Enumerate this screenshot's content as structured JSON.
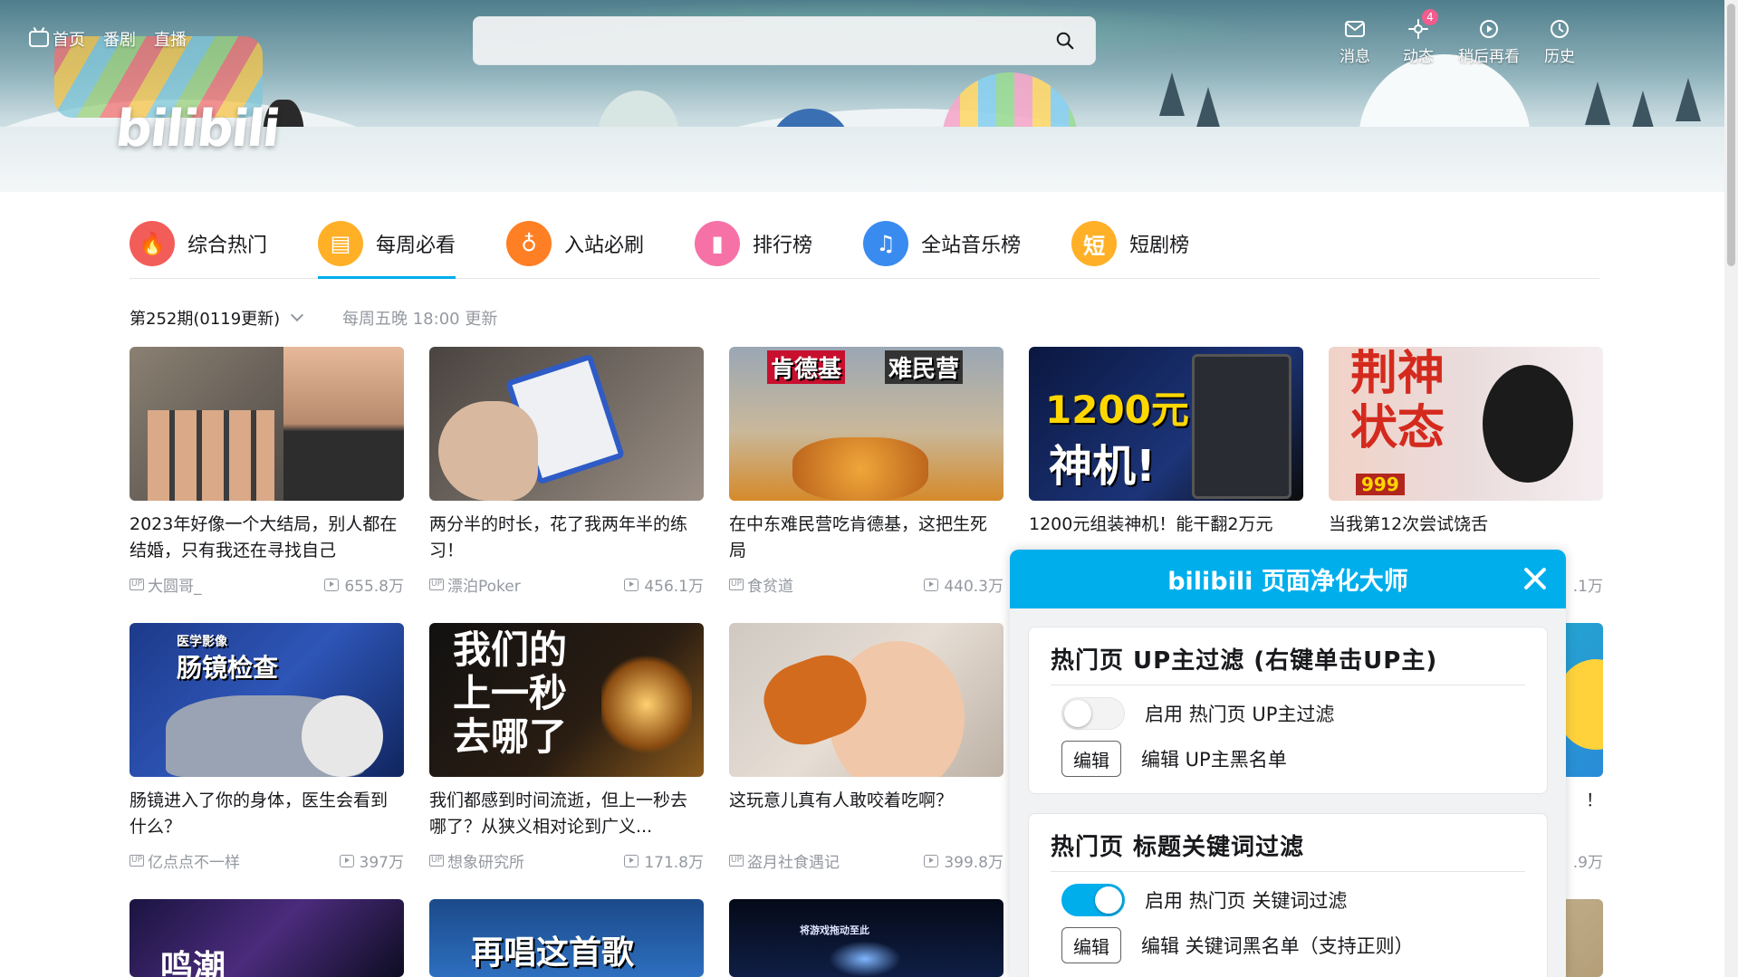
{
  "topnav": {
    "home": "首页",
    "anime": "番剧",
    "live": "直播",
    "logo_text": "bilibili"
  },
  "search": {
    "placeholder": "",
    "icon": "search-icon"
  },
  "user_nav": [
    {
      "label": "消息",
      "icon": "mail-icon",
      "badge": ""
    },
    {
      "label": "动态",
      "icon": "dynamic-icon",
      "badge": "4"
    },
    {
      "label": "稍后再看",
      "icon": "watch-later-icon",
      "badge": ""
    },
    {
      "label": "历史",
      "icon": "history-icon",
      "badge": ""
    }
  ],
  "tabs": [
    {
      "label": "综合热门",
      "color": "#f25d59",
      "glyph": "🔥"
    },
    {
      "label": "每周必看",
      "color": "#ffb027",
      "glyph": "▤"
    },
    {
      "label": "入站必刷",
      "color": "#ff7f24",
      "glyph": "♁"
    },
    {
      "label": "排行榜",
      "color": "#f672a6",
      "glyph": "▮"
    },
    {
      "label": "全站音乐榜",
      "color": "#3a8bef",
      "glyph": "♫"
    },
    {
      "label": "短剧榜",
      "color": "#ffb027",
      "glyph": "短"
    }
  ],
  "issue": {
    "selected": "第252期(0119更新)",
    "note": "每周五晚 18:00 更新"
  },
  "videos": [
    {
      "title": "2023年好像一个大结局，别人都在结婚，只有我还在寻找自己",
      "up": "大圆哥_",
      "views": "655.8万"
    },
    {
      "title": "两分半的时长，花了我两年半的练习！",
      "up": "漂泊Poker",
      "views": "456.1万"
    },
    {
      "title": "在中东难民营吃肯德基，这把生死局",
      "up": "食贫道",
      "views": "440.3万"
    },
    {
      "title": "1200元组装神机！能干翻2万元",
      "up": "",
      "views": ""
    },
    {
      "title": "当我第12次尝试饶舌",
      "up": "",
      "views": ".1万"
    },
    {
      "title": "肠镜进入了你的身体，医生会看到什么？",
      "up": "亿点点不一样",
      "views": "397万"
    },
    {
      "title": "我们都感到时间流逝，但上一秒去哪了？从狭义相对论到广义...",
      "up": "想象研究所",
      "views": "171.8万"
    },
    {
      "title": "这玩意儿真有人敢咬着吃啊？",
      "up": "盗月社食遇记",
      "views": "399.8万"
    },
    {
      "title": "",
      "up": "",
      "views": ""
    },
    {
      "title": "！",
      "up": "",
      "views": ".9万"
    }
  ],
  "thumb_text": {
    "v3a": "肯德基",
    "v3b": "难民营",
    "v4a": "1200元",
    "v4b": "神机!",
    "v5a": "荆神",
    "v5b": "状态",
    "v5c": "999",
    "v6a": "医学影像",
    "v6b": "肠镜检查",
    "v7a": "我们的",
    "v7b": "上一秒",
    "v7c": "去哪了",
    "v11": "鸣潮",
    "v12": "再唱这首歌",
    "v13": "将游戏拖动至此"
  },
  "panel": {
    "title": "bilibili 页面净化大师",
    "groups": [
      {
        "heading": "热门页 UP主过滤 (右键单击UP主)",
        "switch_label": "启用 热门页 UP主过滤",
        "switch_on": false,
        "edit_button": "编辑",
        "edit_label": "编辑 UP主黑名单"
      },
      {
        "heading": "热门页 标题关键词过滤",
        "switch_label": "启用 热门页 关键词过滤",
        "switch_on": true,
        "edit_button": "编辑",
        "edit_label": "编辑 关键词黑名单（支持正则）"
      }
    ]
  },
  "colors": {
    "accent": "#00aeec",
    "pink": "#f25d8e",
    "muted": "#9499a0"
  }
}
